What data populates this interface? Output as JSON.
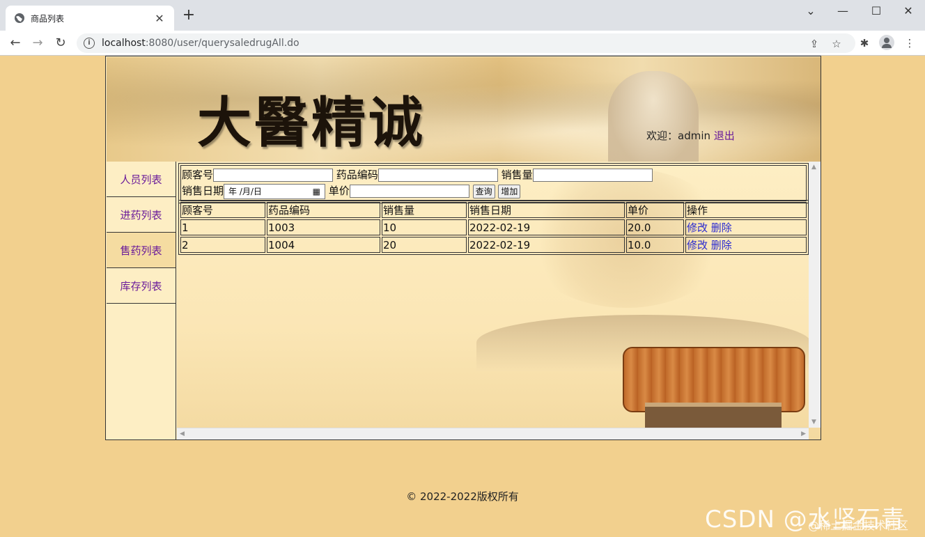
{
  "browser": {
    "tab_title": "商品列表",
    "url_host": "localhost",
    "url_rest": ":8080/user/querysaledrugAll.do"
  },
  "header": {
    "banner_text": "大醫精诚",
    "welcome_label": "欢迎：admin",
    "logout_label": "退出"
  },
  "sidebar": {
    "items": [
      {
        "label": "人员列表"
      },
      {
        "label": "进药列表"
      },
      {
        "label": "售药列表"
      },
      {
        "label": "库存列表"
      }
    ],
    "active_index": 2
  },
  "search": {
    "customer_label": "顾客号",
    "drug_code_label": "药品编码",
    "sales_qty_label": "销售量",
    "sale_date_label": "销售日期",
    "date_placeholder": "年 /月/日",
    "unit_price_label": "单价",
    "query_button": "查询",
    "add_button": "增加"
  },
  "table": {
    "headers": [
      "顾客号",
      "药品编码",
      "销售量",
      "销售日期",
      "单价",
      "操作"
    ],
    "rows": [
      [
        "1",
        "1003",
        "10",
        "2022-02-19",
        "20.0"
      ],
      [
        "2",
        "1004",
        "20",
        "2022-02-19",
        "10.0"
      ]
    ],
    "edit_label": "修改",
    "delete_label": "删除"
  },
  "footer": {
    "copyright": "© 2022-2022版权所有"
  },
  "watermark": {
    "main": "CSDN @水坚石青",
    "sub": "@稀土掘金技术社区"
  }
}
